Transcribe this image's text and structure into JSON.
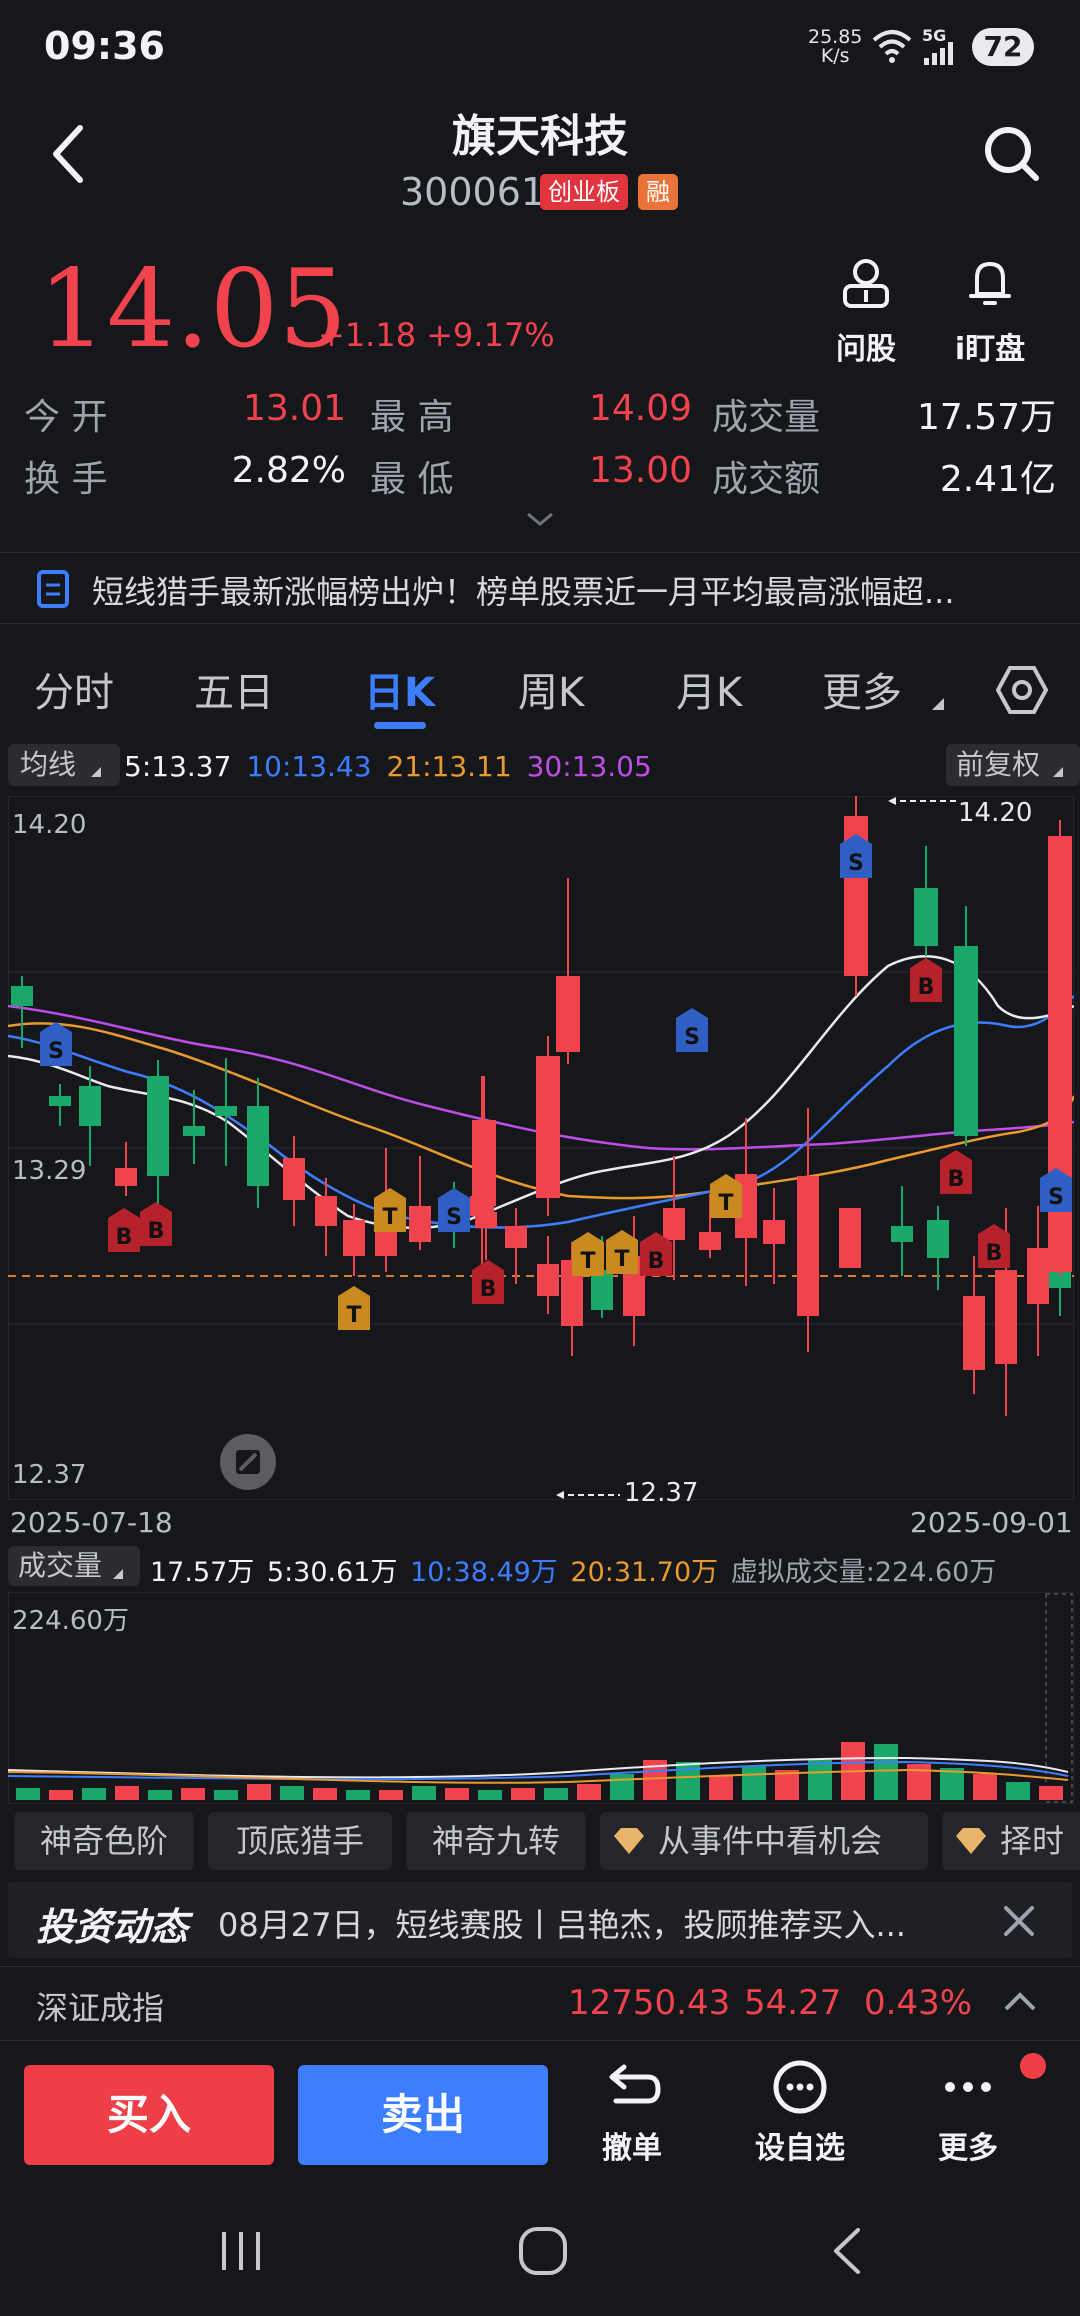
{
  "status": {
    "time": "09:36",
    "net_speed_top": "25.85",
    "net_speed_bottom": "K/s",
    "network": "5G",
    "battery": "72"
  },
  "header": {
    "title": "旗天科技",
    "code": "300061",
    "tag_board": "创业板",
    "tag_margin": "融"
  },
  "quote": {
    "price": "14.05",
    "change": "+1.18",
    "change_pct": "+9.17%"
  },
  "quick_actions": {
    "ask": "问股",
    "watch": "i盯盘"
  },
  "stats": {
    "open_label": "今 开",
    "open": "13.01",
    "high_label": "最 高",
    "high": "14.09",
    "vol_label": "成交量",
    "vol": "17.57万",
    "turnover_label": "换 手",
    "turnover": "2.82%",
    "low_label": "最 低",
    "low": "13.00",
    "amount_label": "成交额",
    "amount": "2.41亿"
  },
  "news": {
    "text": "短线猎手最新涨幅榜出炉！榜单股票近一月平均最高涨幅超..."
  },
  "tabs": [
    "分时",
    "五日",
    "日K",
    "周K",
    "月K",
    "更多"
  ],
  "ma": {
    "selector": "均线",
    "ma5": "5:13.37",
    "ma10": "10:13.43",
    "ma21": "21:13.11",
    "ma30": "30:13.05",
    "adjust": "前复权"
  },
  "chart": {
    "y_top": "14.20",
    "y_mid": "13.29",
    "y_bottom": "12.37",
    "max_label": "14.20",
    "min_label": "12.37",
    "date_start": "2025-07-18",
    "date_end": "2025-09-01"
  },
  "volume": {
    "selector": "成交量",
    "v": "17.57万",
    "ma5": "5:30.61万",
    "ma10": "10:38.49万",
    "ma20": "20:31.70万",
    "virtual": "虚拟成交量:224.60万",
    "y_top": "224.60万"
  },
  "features": [
    "神奇色阶",
    "顶底猎手",
    "神奇九转",
    "从事件中看机会",
    "择时"
  ],
  "invest": {
    "logo": "投资动态",
    "text": "08月27日，短线赛股丨吕艳杰，投顾推荐买入..."
  },
  "index": {
    "name": "深证成指",
    "value": "12750.43",
    "change": "54.27",
    "pct": "0.43%"
  },
  "bottom": {
    "buy": "买入",
    "sell": "卖出",
    "cancel": "撤单",
    "watchlist": "设自选",
    "more": "更多"
  },
  "colors": {
    "up": "#f0434e",
    "down": "#19a86a",
    "accent": "#3d7dff",
    "ma5": "#e9e9ee",
    "ma10": "#3d7dff",
    "ma21": "#e89a2f",
    "ma30": "#bf4de7"
  }
}
